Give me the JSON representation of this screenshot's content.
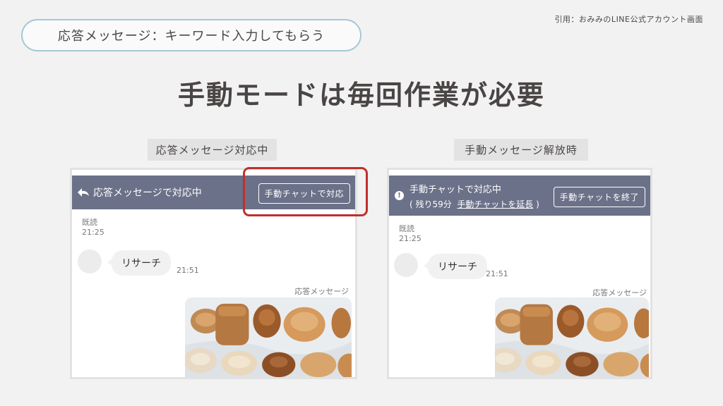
{
  "citation": "引用：おみみのLINE公式アカウント画面",
  "section_pill": "応答メッセージ：キーワード入力してもらう",
  "headline": "手動モードは毎回作業が必要",
  "left": {
    "caption": "応答メッセージ対応中",
    "bar_title": "応答メッセージで対応中",
    "bar_button": "手動チャットで対応",
    "read_label": "既読",
    "read_time": "21:25",
    "bubble_text": "リサーチ",
    "bubble_time": "21:51",
    "auto_reply_label": "応答メッセージ"
  },
  "right": {
    "caption": "手動メッセージ解放時",
    "bar_title": "手動チャットで対応中",
    "remaining_prefix": "( 残り59分",
    "extend_link": "手動チャットを延長",
    "remaining_suffix": ")",
    "bar_button": "手動チャットを終了",
    "read_label": "既読",
    "read_time": "21:25",
    "bubble_text": "リサーチ",
    "bubble_time": "21:51",
    "auto_reply_label": "応答メッセージ"
  },
  "colors": {
    "header_bar": "#6b7188",
    "highlight": "#c0302b",
    "pill_border": "#a7c7d6"
  },
  "icons": {
    "back": "reply-arrow-icon",
    "info": "exclamation-circle-icon"
  }
}
